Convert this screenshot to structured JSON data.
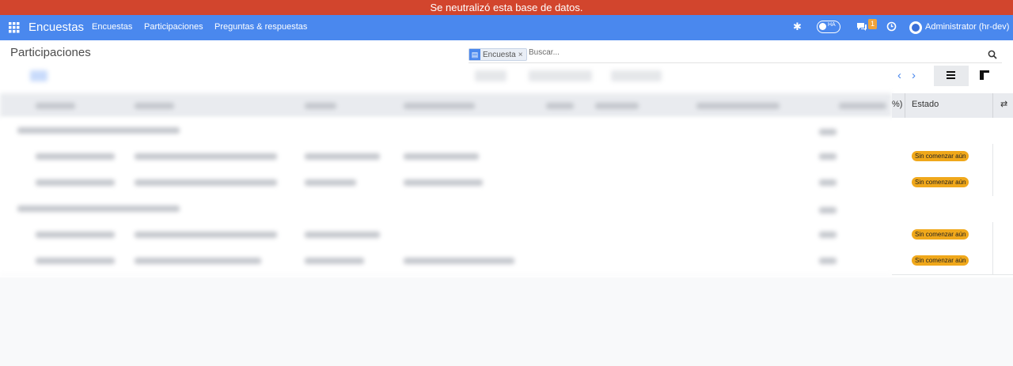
{
  "banner": {
    "text": "Se neutralizó esta base de datos."
  },
  "navbar": {
    "apps_icon": "grid-icon",
    "brand": "Encuestas",
    "items": [
      "Encuestas",
      "Participaciones",
      "Preguntas & respuestas"
    ],
    "toggle_label": "HA",
    "chat_badge": "1",
    "user": "Administrator (hr-dev)"
  },
  "page": {
    "title": "Participaciones"
  },
  "search": {
    "facet_label": "Encuesta",
    "facet_icon": "layers-icon",
    "placeholder": "Buscar..."
  },
  "list": {
    "visible_headers": {
      "partial_col": "%)",
      "status": "Estado"
    },
    "rows": [
      {
        "group": true,
        "status": ""
      },
      {
        "group": false,
        "status": "Sin comenzar aún"
      },
      {
        "group": false,
        "status": "Sin comenzar aún"
      },
      {
        "group": true,
        "status": ""
      },
      {
        "group": false,
        "status": "Sin comenzar aún"
      },
      {
        "group": false,
        "status": "Sin comenzar aún"
      }
    ]
  },
  "colors": {
    "banner": "#d2452d",
    "navbar": "#4a88ee",
    "badge": "#f0a81b"
  }
}
